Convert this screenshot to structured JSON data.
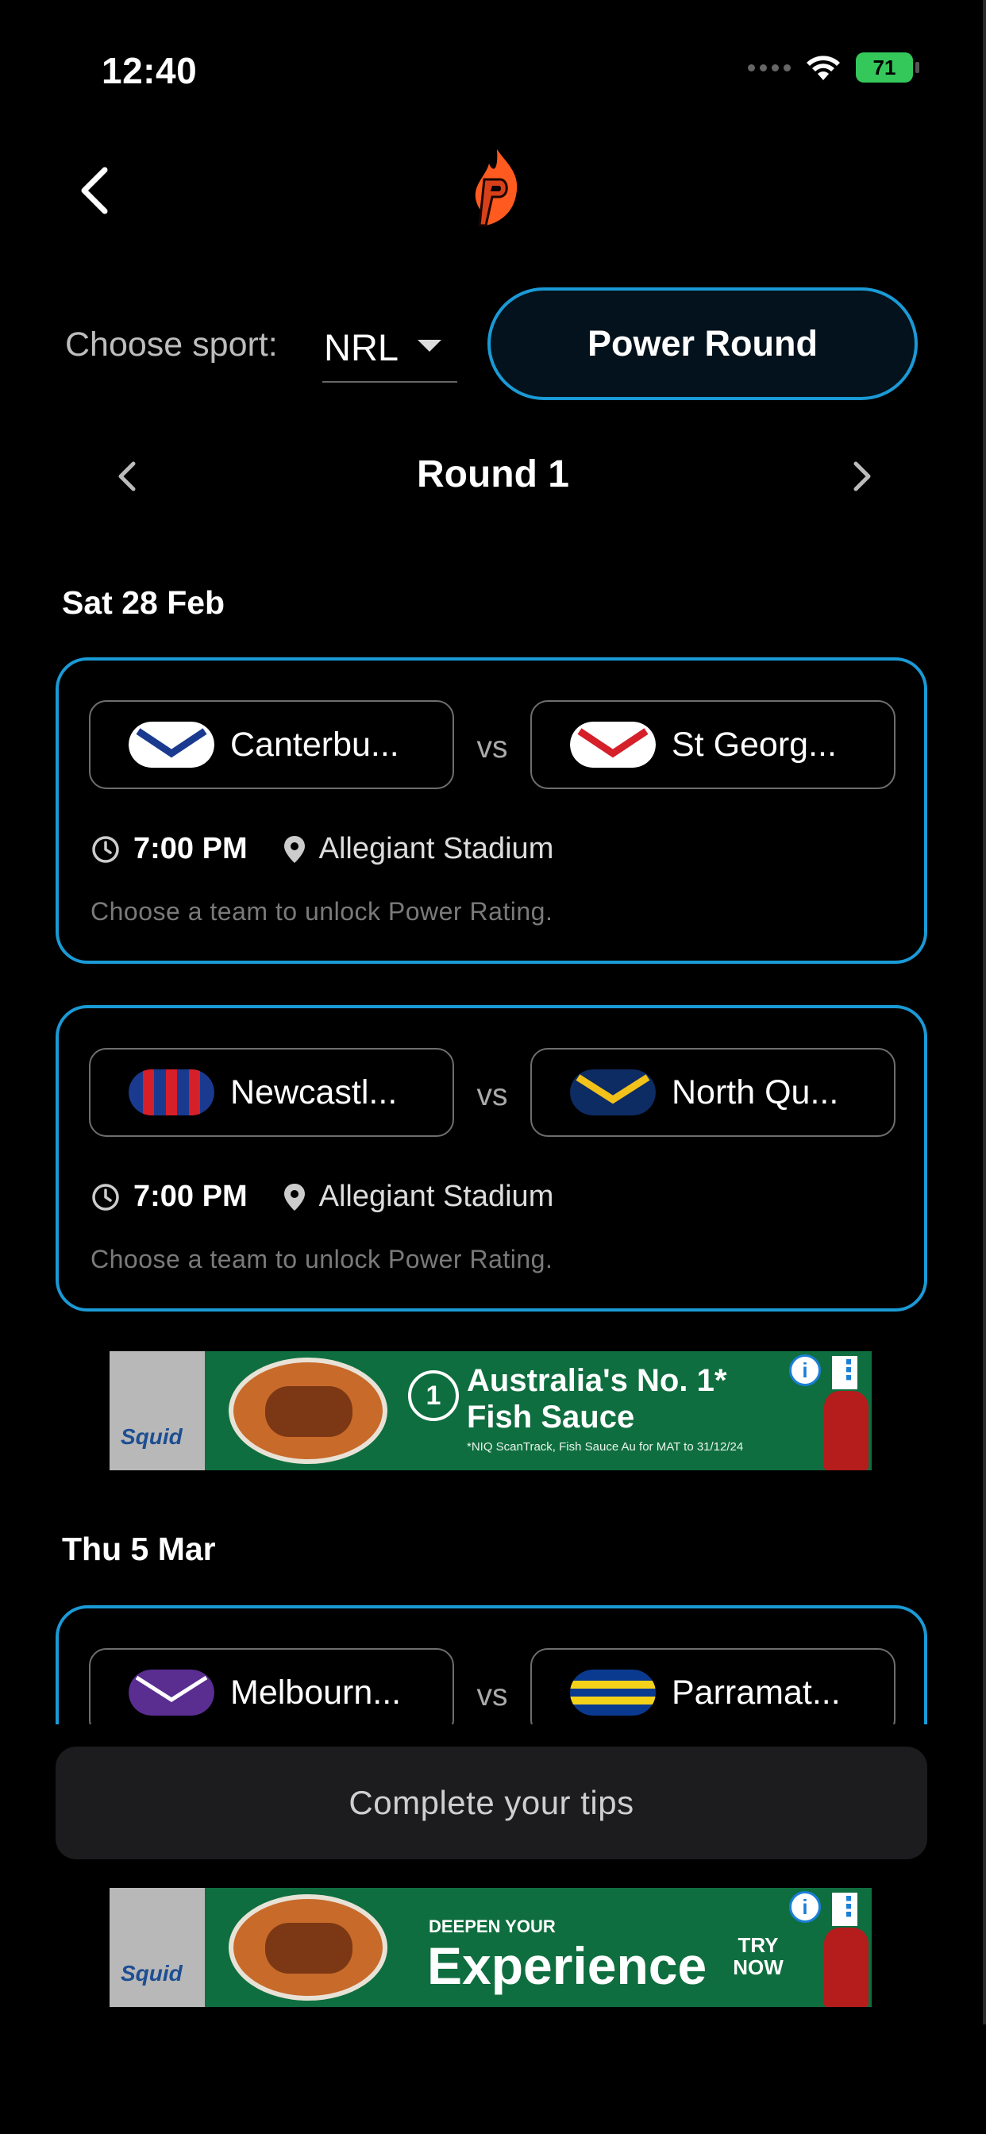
{
  "status_bar": {
    "time": "12:40",
    "battery": "71"
  },
  "header": {
    "back_icon": "chevron-left-icon",
    "logo_icon": "flame-p-logo"
  },
  "sport_selector": {
    "label": "Choose sport:",
    "value": "NRL"
  },
  "power_button": {
    "label": "Power Round"
  },
  "round_nav": {
    "title": "Round 1"
  },
  "days": [
    {
      "date": "Sat 28 Feb",
      "matches": [
        {
          "home": {
            "name": "Canterbu...",
            "colors": [
              "#ffffff",
              "#1a3a8f"
            ]
          },
          "away": {
            "name": "St Georg...",
            "colors": [
              "#ffffff",
              "#d5202a"
            ]
          },
          "vs": "vs",
          "time": "7:00 PM",
          "venue": "Allegiant Stadium",
          "note": "Choose a team to unlock Power Rating."
        },
        {
          "home": {
            "name": "Newcastl...",
            "colors": [
              "#1a3a8f",
              "#d5202a"
            ]
          },
          "away": {
            "name": "North Qu...",
            "colors": [
              "#0c2c63",
              "#f2c21a"
            ]
          },
          "vs": "vs",
          "time": "7:00 PM",
          "venue": "Allegiant Stadium",
          "note": "Choose a team to unlock Power Rating."
        }
      ]
    },
    {
      "date": "Thu 5 Mar",
      "matches": [
        {
          "home": {
            "name": "Melbourn...",
            "colors": [
              "#5a2d91",
              "#ffffff"
            ]
          },
          "away": {
            "name": "Parramat...",
            "colors": [
              "#0a3a8f",
              "#f5d21a"
            ]
          },
          "vs": "vs"
        }
      ]
    }
  ],
  "ads": [
    {
      "brand": "Squid",
      "headline": "Australia's No. 1* Fish Sauce",
      "fine_print": "*NIQ ScanTrack, Fish Sauce Au for MAT to 31/12/24",
      "medal": "1"
    },
    {
      "brand": "Squid",
      "pre": "DEEPEN YOUR",
      "headline": "Experience",
      "cta": "TRY NOW"
    }
  ],
  "footer": {
    "complete_label": "Complete your tips"
  },
  "colors": {
    "accent": "#1a9ad6",
    "background": "#000000",
    "button_dark": "#1c1c1e"
  }
}
